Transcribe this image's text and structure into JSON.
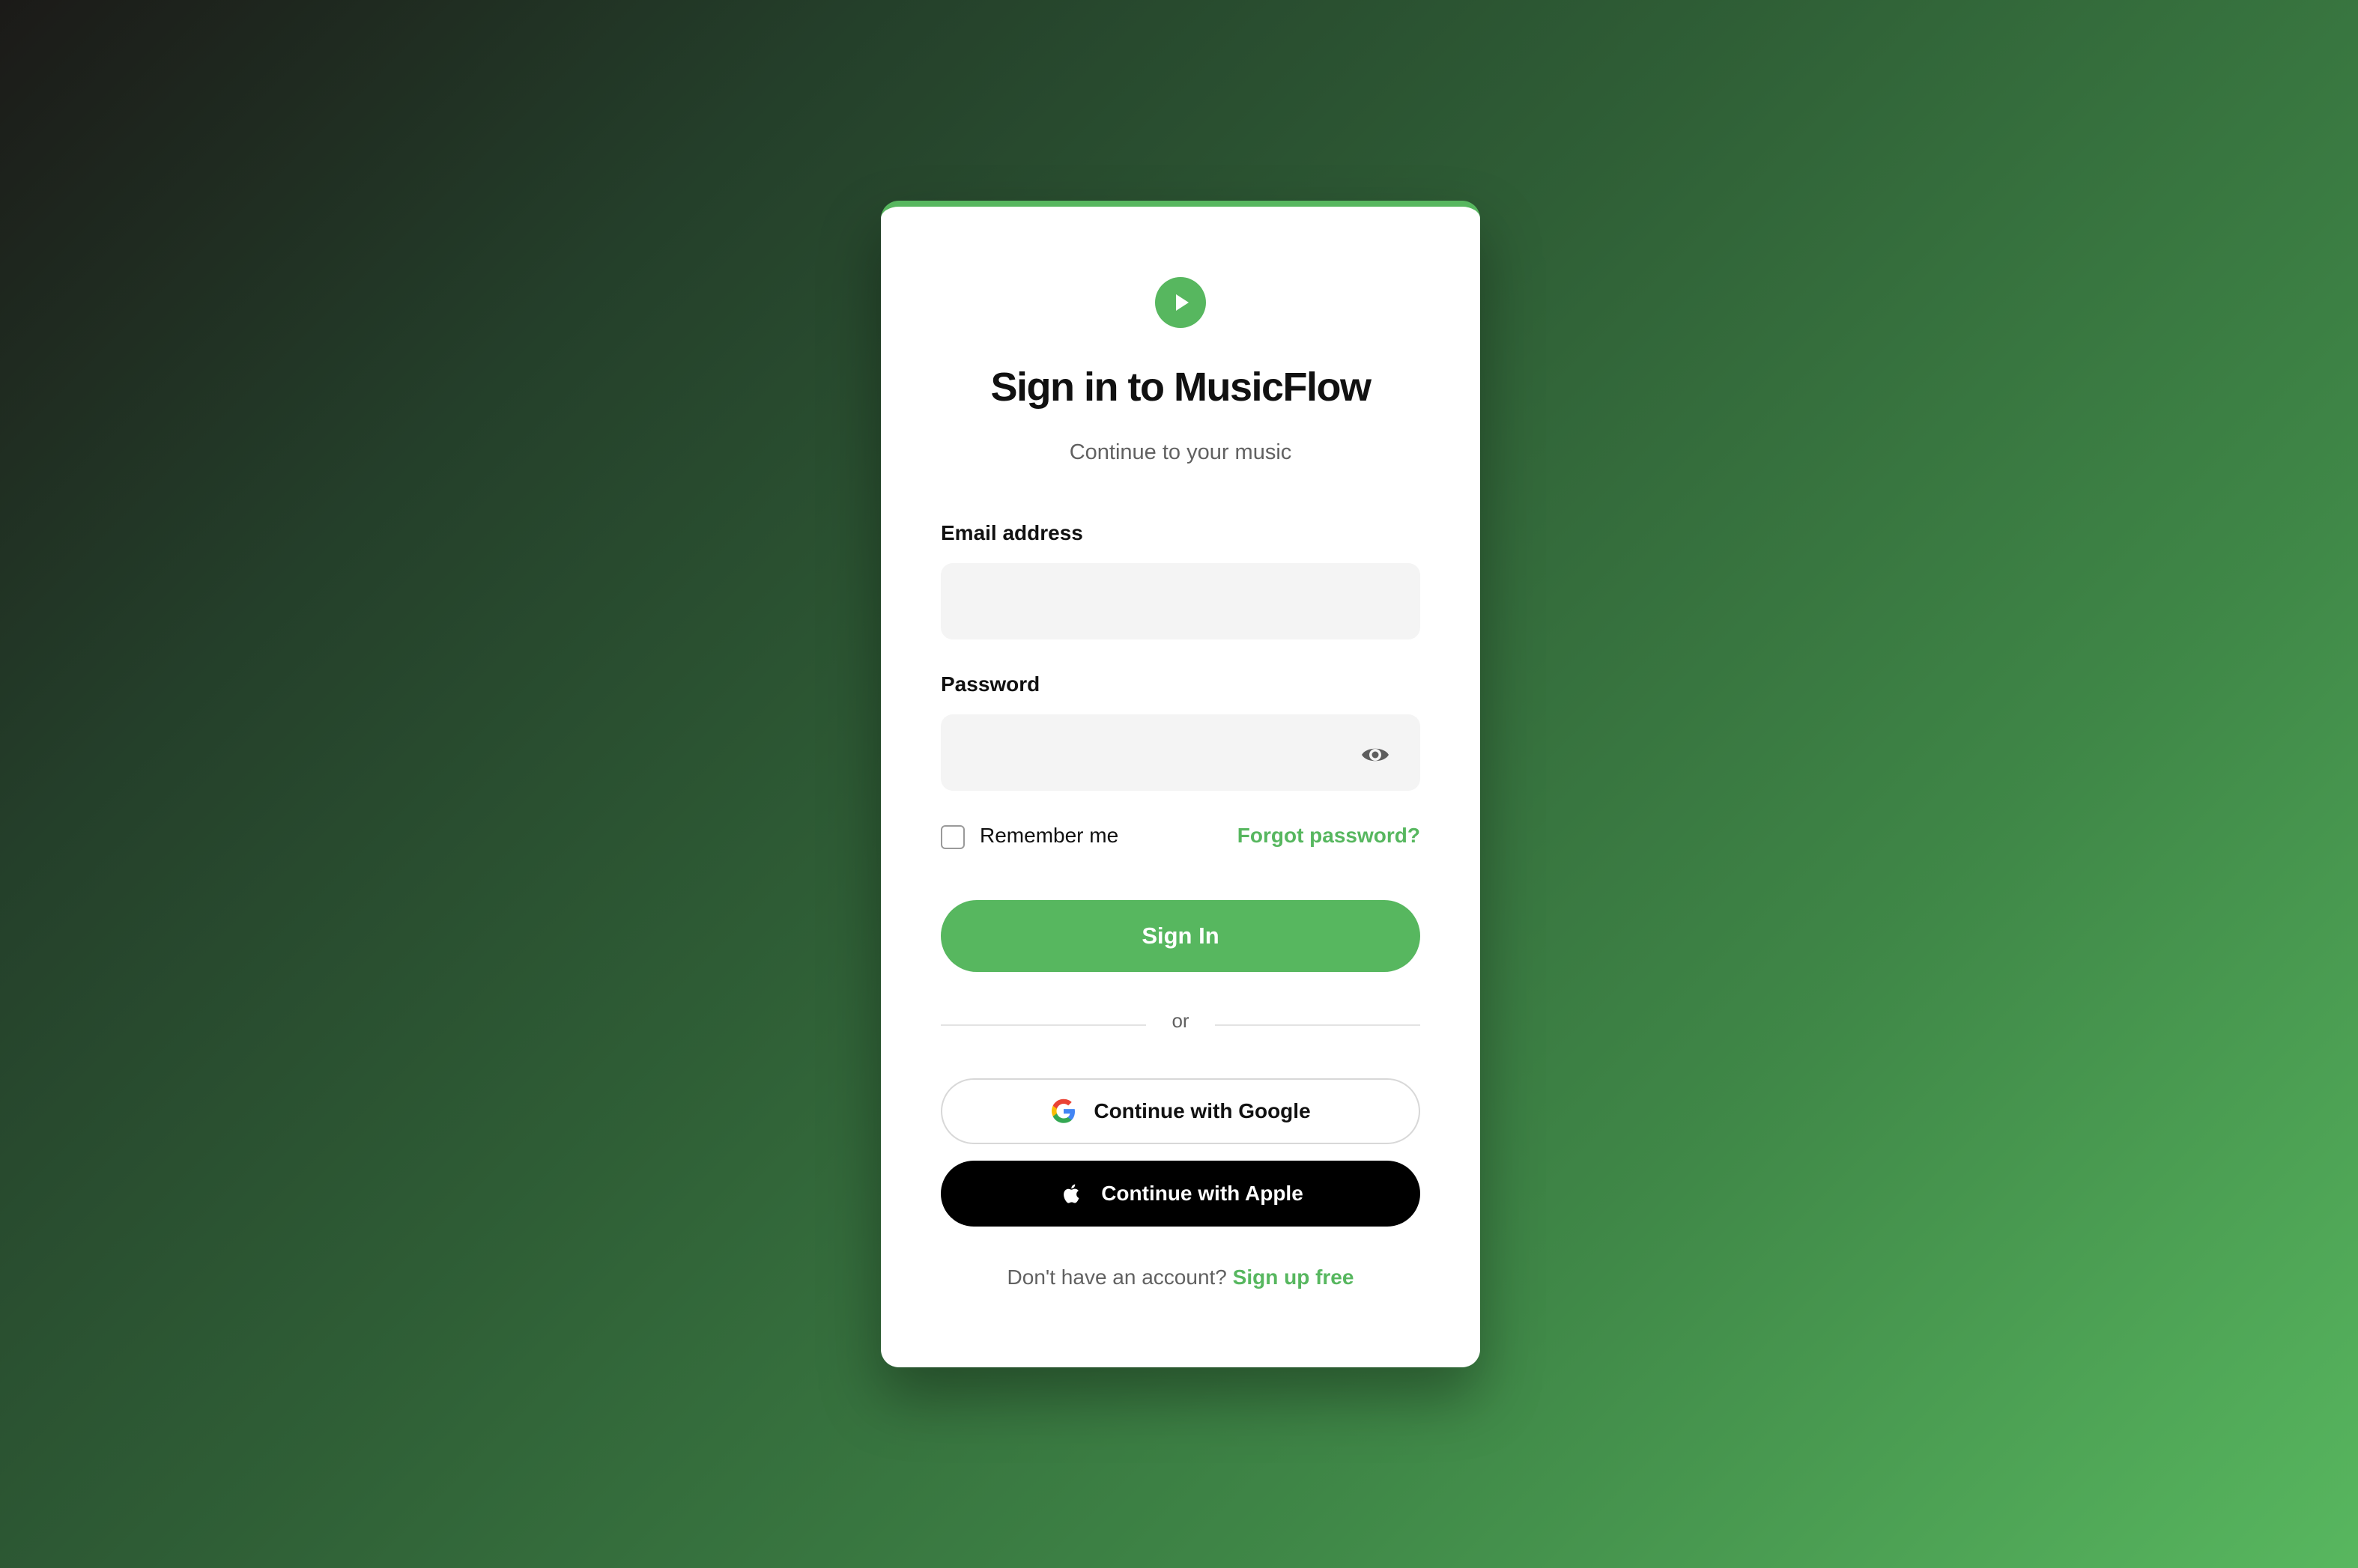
{
  "app": {
    "title": "Sign in to MusicFlow",
    "subtitle": "Continue to your music",
    "logo_icon": "play-icon",
    "accent_color": "#57b75f"
  },
  "form": {
    "email": {
      "label": "Email address",
      "value": "",
      "placeholder": ""
    },
    "password": {
      "label": "Password",
      "value": "",
      "placeholder": "",
      "toggle_icon": "eye-icon"
    },
    "remember": {
      "label": "Remember me",
      "checked": false
    },
    "forgot_label": "Forgot password?",
    "submit_label": "Sign In"
  },
  "divider": {
    "label": "or"
  },
  "social": {
    "google": {
      "label": "Continue with Google",
      "icon": "google-icon"
    },
    "apple": {
      "label": "Continue with Apple",
      "icon": "apple-icon"
    }
  },
  "footer": {
    "prompt": "Don't have an account?",
    "signup_label": "Sign up free"
  }
}
